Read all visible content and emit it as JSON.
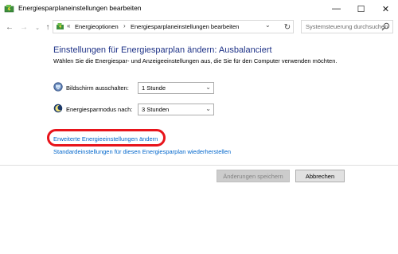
{
  "window": {
    "title": "Energiesparplaneinstellungen bearbeiten",
    "minimize_glyph": "—",
    "maximize_glyph": "☐",
    "close_glyph": "✕"
  },
  "nav": {
    "back_glyph": "←",
    "forward_glyph": "→",
    "history_glyph": "⌄",
    "up_glyph": "↑",
    "address": {
      "prefix": "«",
      "separator": "›",
      "items": [
        "Energieoptionen",
        "Energiesparplaneinstellungen bearbeiten"
      ],
      "dropdown_glyph": "⌄",
      "refresh_glyph": "↻"
    },
    "search_placeholder": "Systemsteuerung durchsuchen"
  },
  "main": {
    "heading": "Einstellungen für Energiesparplan ändern: Ausbalanciert",
    "description": "Wählen Sie die Energiespar- und Anzeigeeinstellungen aus, die Sie für den Computer verwenden möchten.",
    "settings": [
      {
        "icon": "display-power-icon",
        "label": "Bildschirm ausschalten:",
        "value": "1 Stunde"
      },
      {
        "icon": "sleep-moon-icon",
        "label": "Energiesparmodus nach:",
        "value": "3 Stunden"
      }
    ],
    "select_chevron": "⌄",
    "links": {
      "advanced": "Erweiterte Energieeinstellungen ändern",
      "restore": "Standardeinstellungen für diesen Energiesparplan wiederherstellen"
    },
    "annotation_color": "#e8141b"
  },
  "footer": {
    "save_label": "Änderungen speichern",
    "save_enabled": false,
    "cancel_label": "Abbrechen"
  },
  "colors": {
    "heading": "#1e3287",
    "link": "#0066cc"
  }
}
